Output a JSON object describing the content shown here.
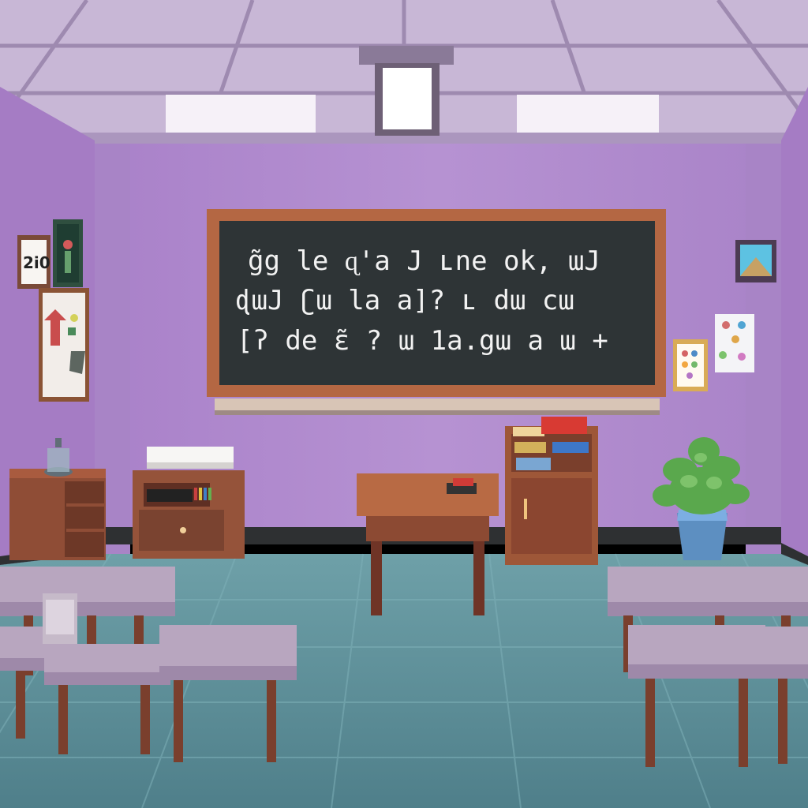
{
  "scene": {
    "title": "",
    "colors": {
      "wall": "#b48fd0",
      "wall_dark": "#9d78be",
      "ceiling": "#c9b3d6",
      "floor": "#5f8f99",
      "chalkboard": "#2d3436",
      "board_frame": "#b26542",
      "wood": "#9a4f35",
      "desk_top": "#b9a7bf",
      "plant": "#58b24a",
      "pot": "#5f8ebe"
    }
  },
  "chalkboard": {
    "lines": [
      "g̃g le ɋ'a J   ʟne  ok, ɯJ",
      "ɖɯJ ʗɯ   la a]?  ʟ   dɯ  cɯ",
      "[ʔ de ɛ̃ ?   ɯ   1a.gɯ a ɯ   +"
    ]
  },
  "wall_left": {
    "poster_number_text": "2i0"
  },
  "icons": {
    "ceiling_light": "ceiling-light-icon",
    "poster": "poster-icon",
    "plant": "plant-icon",
    "chair": "chair-icon"
  }
}
